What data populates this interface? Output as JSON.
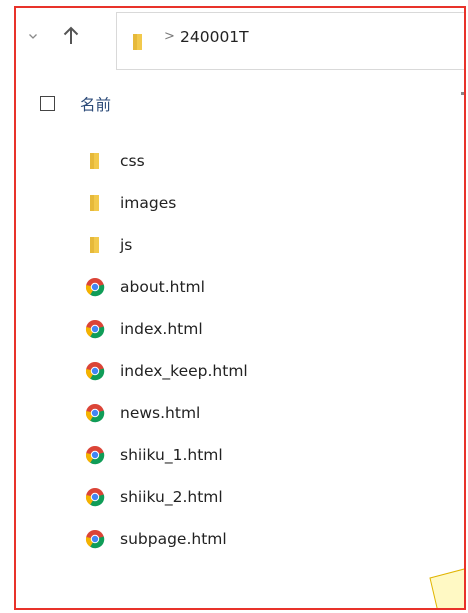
{
  "navbar": {
    "breadcrumb_separator": ">",
    "current_folder": "240001T"
  },
  "header": {
    "name_column_label": "名前"
  },
  "files": [
    {
      "name": "css",
      "icon": "folder-icon"
    },
    {
      "name": "images",
      "icon": "folder-icon"
    },
    {
      "name": "js",
      "icon": "folder-icon"
    },
    {
      "name": "about.html",
      "icon": "chrome-icon"
    },
    {
      "name": "index.html",
      "icon": "chrome-icon"
    },
    {
      "name": "index_keep.html",
      "icon": "chrome-icon"
    },
    {
      "name": "news.html",
      "icon": "chrome-icon"
    },
    {
      "name": "shiiku_1.html",
      "icon": "chrome-icon"
    },
    {
      "name": "shiiku_2.html",
      "icon": "chrome-icon"
    },
    {
      "name": "subpage.html",
      "icon": "chrome-icon"
    }
  ],
  "colors": {
    "highlight_border": "#e8322a",
    "folder": "#f2c94c",
    "callout_fill": "#fff9c4"
  }
}
